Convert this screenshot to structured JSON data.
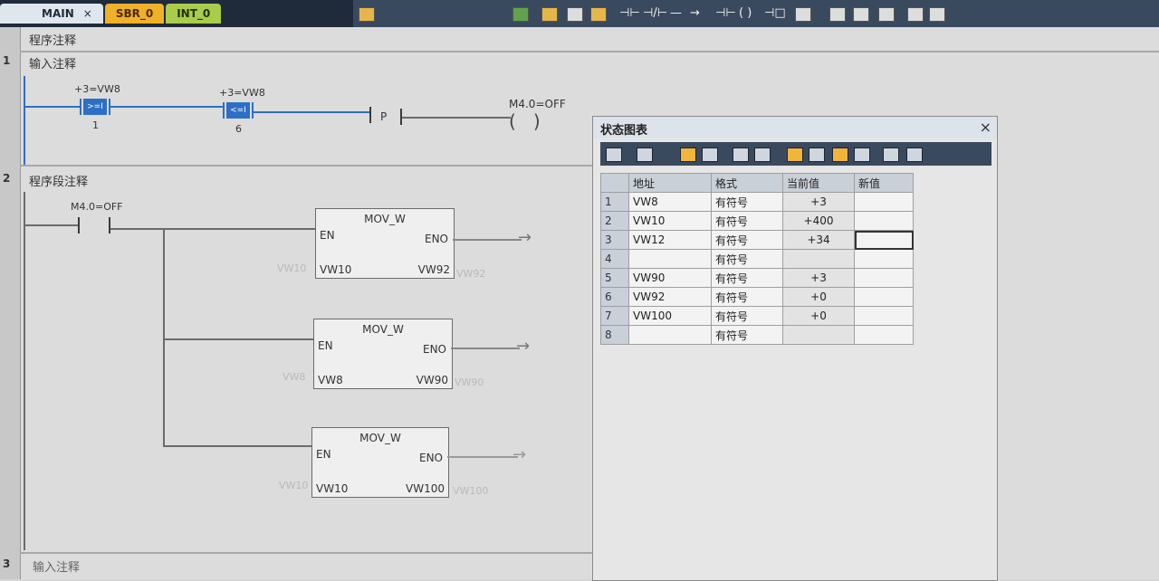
{
  "tabs": [
    {
      "label": "MAIN",
      "close": "×"
    },
    {
      "label": "SBR_0"
    },
    {
      "label": "INT_0"
    }
  ],
  "toolbar_glyphs": [
    "⊣⊢",
    "⊣/⊢",
    "—",
    "→",
    "⊣⊢",
    "( )",
    "⊣□"
  ],
  "program_comment": "程序注释",
  "networks": [
    {
      "number": "1",
      "comment": "输入注释",
      "contacts": [
        {
          "top": "+3=VW8",
          "op": ">=I",
          "bottom": "1"
        },
        {
          "top": "+3=VW8",
          "op": "<=I",
          "bottom": "6"
        }
      ],
      "p_label": "P",
      "coil_label": "M4.0=OFF"
    },
    {
      "number": "2",
      "comment": "程序段注释",
      "contact_label": "M4.0=OFF",
      "blocks": [
        {
          "title": "MOV_W",
          "en": "EN",
          "eno": "ENO",
          "in": "VW10",
          "out": "VW92",
          "in_ghost": "VW10",
          "out_ghost": "VW92"
        },
        {
          "title": "MOV_W",
          "en": "EN",
          "eno": "ENO",
          "in": "VW8",
          "out": "VW90",
          "in_ghost": "VW8",
          "out_ghost": "VW90"
        },
        {
          "title": "MOV_W",
          "en": "EN",
          "eno": "ENO",
          "in": "VW10",
          "out": "VW100",
          "in_ghost": "VW10",
          "out_ghost": "VW100"
        }
      ]
    },
    {
      "number": "3",
      "comment": "输入注释"
    }
  ],
  "status_chart": {
    "title": "状态图表",
    "close": "×",
    "headers": [
      "",
      "地址",
      "格式",
      "当前值",
      "新值"
    ],
    "rows": [
      {
        "n": "1",
        "addr": "VW8",
        "fmt": "有符号",
        "val": "+3",
        "nv": ""
      },
      {
        "n": "2",
        "addr": "VW10",
        "fmt": "有符号",
        "val": "+400",
        "nv": ""
      },
      {
        "n": "3",
        "addr": "VW12",
        "fmt": "有符号",
        "val": "+34",
        "nv": ""
      },
      {
        "n": "4",
        "addr": "",
        "fmt": "有符号",
        "val": "",
        "nv": ""
      },
      {
        "n": "5",
        "addr": "VW90",
        "fmt": "有符号",
        "val": "+3",
        "nv": ""
      },
      {
        "n": "6",
        "addr": "VW92",
        "fmt": "有符号",
        "val": "+0",
        "nv": ""
      },
      {
        "n": "7",
        "addr": "VW100",
        "fmt": "有符号",
        "val": "+0",
        "nv": ""
      },
      {
        "n": "8",
        "addr": "",
        "fmt": "有符号",
        "val": "",
        "nv": ""
      }
    ]
  },
  "colors": {
    "accent": "#2d6fc6",
    "tab_main": "#dfe6ee",
    "tab_sbr": "#f0b028",
    "tab_int": "#a9cc4a"
  }
}
